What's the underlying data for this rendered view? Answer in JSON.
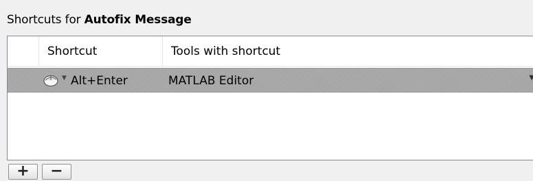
{
  "title": {
    "prefix": "Shortcuts for ",
    "name": "Autofix Message"
  },
  "table": {
    "columns": [
      "",
      "Shortcut",
      "Tools with shortcut"
    ],
    "rows": [
      {
        "icon": "mouse-icon",
        "shortcut": "Alt+Enter",
        "tools": "MATLAB Editor"
      }
    ]
  },
  "buttons": {
    "add": "+",
    "remove": "−"
  }
}
